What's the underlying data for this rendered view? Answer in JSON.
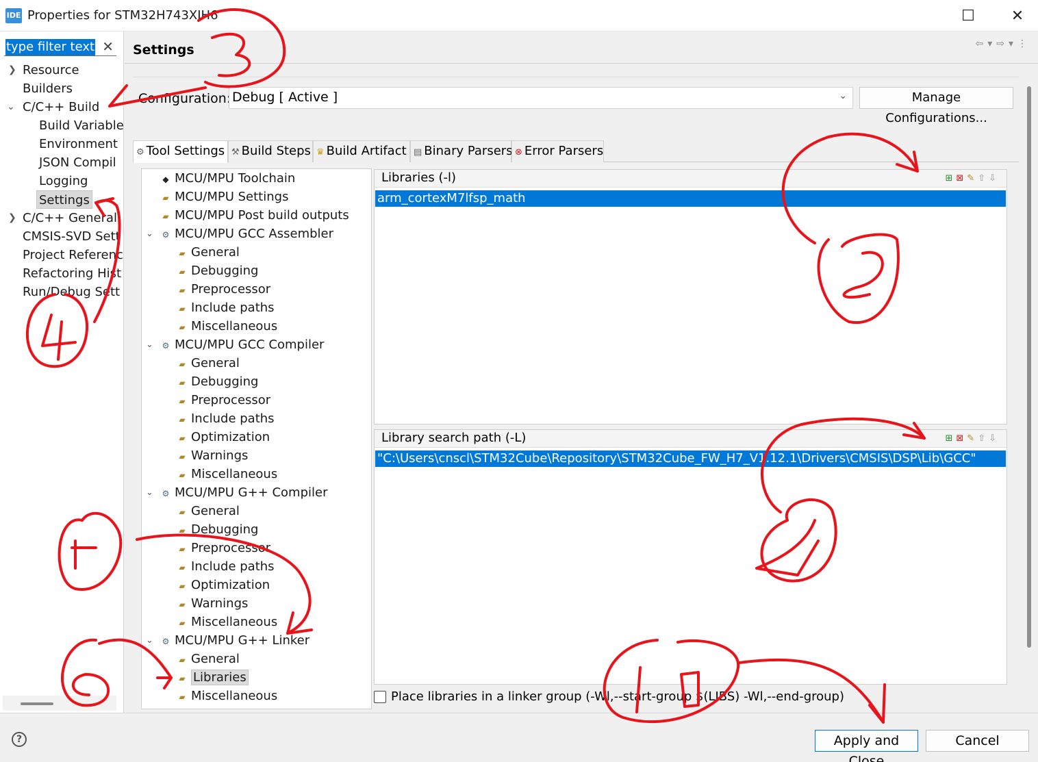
{
  "window": {
    "icon_text": "IDE",
    "title": "Properties for STM32H743XIH6",
    "maximize_glyph": "☐",
    "close_glyph": "✕"
  },
  "left_nav": {
    "filter_text": "type filter text",
    "items": [
      {
        "label": "Resource"
      },
      {
        "label": "Builders"
      },
      {
        "label": "C/C++ Build"
      },
      {
        "label": "Build Variable"
      },
      {
        "label": "Environment"
      },
      {
        "label": "JSON Compil"
      },
      {
        "label": "Logging"
      },
      {
        "label": "Settings"
      },
      {
        "label": "C/C++ General"
      },
      {
        "label": "CMSIS-SVD Sett"
      },
      {
        "label": "Project Referenc"
      },
      {
        "label": "Refactoring Hist"
      },
      {
        "label": "Run/Debug Sett"
      }
    ]
  },
  "header": {
    "title": "Settings"
  },
  "configuration": {
    "label": "Configuration:",
    "value": "Debug  [ Active ]",
    "manage_label": "Manage Configurations..."
  },
  "tabs": [
    {
      "label": "Tool Settings",
      "icon": "gear-icon"
    },
    {
      "label": "Build Steps",
      "icon": "hammer-icon"
    },
    {
      "label": "Build Artifact",
      "icon": "trophy-icon"
    },
    {
      "label": "Binary Parsers",
      "icon": "binary-icon"
    },
    {
      "label": "Error Parsers",
      "icon": "error-icon"
    }
  ],
  "tool_tree": [
    {
      "label": "MCU/MPU Toolchain"
    },
    {
      "label": "MCU/MPU Settings"
    },
    {
      "label": "MCU/MPU Post build outputs"
    },
    {
      "label": "MCU/MPU GCC Assembler"
    },
    {
      "label": "General"
    },
    {
      "label": "Debugging"
    },
    {
      "label": "Preprocessor"
    },
    {
      "label": "Include paths"
    },
    {
      "label": "Miscellaneous"
    },
    {
      "label": "MCU/MPU GCC Compiler"
    },
    {
      "label": "General"
    },
    {
      "label": "Debugging"
    },
    {
      "label": "Preprocessor"
    },
    {
      "label": "Include paths"
    },
    {
      "label": "Optimization"
    },
    {
      "label": "Warnings"
    },
    {
      "label": "Miscellaneous"
    },
    {
      "label": "MCU/MPU G++ Compiler"
    },
    {
      "label": "General"
    },
    {
      "label": "Debugging"
    },
    {
      "label": "Preprocessor"
    },
    {
      "label": "Include paths"
    },
    {
      "label": "Optimization"
    },
    {
      "label": "Warnings"
    },
    {
      "label": "Miscellaneous"
    },
    {
      "label": "MCU/MPU G++ Linker"
    },
    {
      "label": "General"
    },
    {
      "label": "Libraries"
    },
    {
      "label": "Miscellaneous"
    }
  ],
  "libraries": {
    "header": "Libraries (-l)",
    "items": [
      "arm_cortexM7lfsp_math"
    ]
  },
  "library_paths": {
    "header": "Library search path (-L)",
    "items": [
      "\"C:\\Users\\cnscl\\STM32Cube\\Repository\\STM32Cube_FW_H7_V1.12.1\\Drivers\\CMSIS\\DSP\\Lib\\GCC\""
    ]
  },
  "linker_group": {
    "label": "Place libraries in a linker group (-Wl,--start-group $(LIBS) -Wl,--end-group)",
    "checked": false
  },
  "footer": {
    "help_glyph": "?",
    "apply_close_label": "Apply and Close",
    "cancel_label": "Cancel"
  },
  "colors": {
    "selection": "#0078d7",
    "annotation": "#e8141b"
  }
}
